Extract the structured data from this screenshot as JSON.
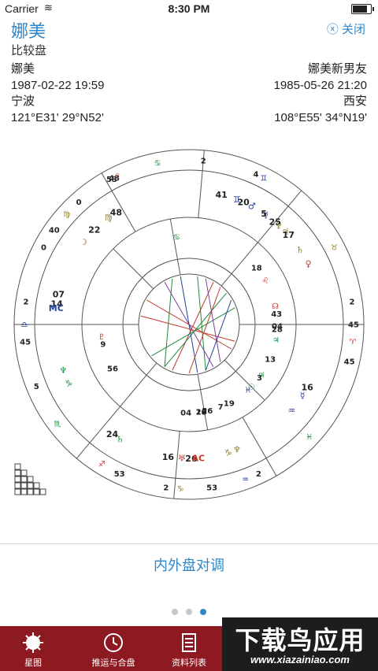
{
  "status_bar": {
    "carrier": "Carrier",
    "time": "8:30 PM",
    "battery_level": 0.9
  },
  "header": {
    "title": "娜美",
    "close_label": "ⓧ 关闭",
    "subtitle": "比较盘"
  },
  "person_left": {
    "name": "娜美",
    "datetime": "1987-02-22 19:59",
    "place": "宁波",
    "coords": "121°E31' 29°N52'"
  },
  "person_right": {
    "name": "娜美新男友",
    "datetime": "1985-05-26 21:20",
    "place": "西安",
    "coords": "108°E55' 34°N19'"
  },
  "chart_data": {
    "type": "astrology-biwheel",
    "outer_labels": [
      {
        "text": "2",
        "deg": 95
      },
      {
        "text": "53",
        "deg": 62
      },
      {
        "text": "♋",
        "deg": 79,
        "color": "#1e8a3a"
      },
      {
        "text": "4",
        "deg": 114
      },
      {
        "text": "♊",
        "deg": 117,
        "color": "#233f9c"
      },
      {
        "text": "♉",
        "deg": 152,
        "color": "#8a7d20"
      },
      {
        "text": "2",
        "deg": 172
      },
      {
        "text": "45",
        "deg": 180
      },
      {
        "text": "♈",
        "deg": 186,
        "color": "#c0392b"
      },
      {
        "text": "45",
        "deg": 193
      },
      {
        "text": "♓",
        "deg": 223,
        "color": "#1e8a3a"
      },
      {
        "text": "2",
        "deg": 245
      },
      {
        "text": "♒",
        "deg": 250,
        "color": "#233f9c"
      },
      {
        "text": "53",
        "deg": 262
      },
      {
        "text": "♑",
        "deg": 273,
        "color": "#8a7d20"
      },
      {
        "text": "2",
        "deg": 278
      },
      {
        "text": "53",
        "deg": 295
      },
      {
        "text": "♐",
        "deg": 302,
        "color": "#c0392b"
      },
      {
        "text": "5",
        "deg": 338
      },
      {
        "text": "♏",
        "deg": 323,
        "color": "#1e8a3a"
      },
      {
        "text": "45",
        "deg": 354
      },
      {
        "text": "♎",
        "deg": 0,
        "color": "#233f9c"
      },
      {
        "text": "2",
        "deg": 8
      },
      {
        "text": "0",
        "deg": 28
      },
      {
        "text": "40",
        "deg": 35
      },
      {
        "text": "♍",
        "deg": 42,
        "color": "#8a7d20"
      },
      {
        "text": "0",
        "deg": 48
      },
      {
        "text": "43",
        "deg": 63
      },
      {
        "text": "♌",
        "deg": 64,
        "color": "#c0392b"
      }
    ],
    "outer_planets": [
      {
        "text": "♂",
        "deg": 118,
        "color": "#233f9c"
      },
      {
        "text": "20",
        "deg": 114
      },
      {
        "text": "♊",
        "deg": 111,
        "color": "#233f9c"
      },
      {
        "text": "41",
        "deg": 104
      },
      {
        "text": "☿",
        "deg": 125,
        "color": "#233f9c"
      },
      {
        "text": "5",
        "deg": 124
      },
      {
        "text": "♃",
        "deg": 136,
        "color": "#8a7d20"
      },
      {
        "text": "17",
        "deg": 138
      },
      {
        "text": "♄",
        "deg": 146,
        "color": "#8a7d20"
      },
      {
        "text": "♀",
        "deg": 132,
        "color": "#8a7d20"
      },
      {
        "text": "25",
        "deg": 130
      },
      {
        "text": "♀",
        "deg": 153,
        "color": "#c0392b"
      },
      {
        "text": "☽",
        "deg": 38,
        "color": "#c0392b"
      },
      {
        "text": "22",
        "deg": 45
      },
      {
        "text": "♍",
        "deg": 53,
        "color": "#8a7d20"
      },
      {
        "text": "48",
        "deg": 57
      },
      {
        "text": "14",
        "deg": 9
      },
      {
        "text": "07",
        "deg": 13
      },
      {
        "text": "MC",
        "deg": 7,
        "color": "#233f9c"
      },
      {
        "text": "♆",
        "deg": 340,
        "color": "#1e8a3a"
      },
      {
        "text": "♑",
        "deg": 334,
        "color": "#1e8a3a"
      },
      {
        "text": "24",
        "deg": 305
      },
      {
        "text": "♄",
        "deg": 301,
        "color": "#1e8a3a"
      },
      {
        "text": "16",
        "deg": 279
      },
      {
        "text": "♅",
        "deg": 273,
        "color": "#c0392b"
      },
      {
        "text": "26",
        "deg": 269
      },
      {
        "text": "AC",
        "deg": 266,
        "color": "#c0392b"
      },
      {
        "text": "♑",
        "deg": 253,
        "color": "#8a7d20"
      },
      {
        "text": "♆",
        "deg": 249,
        "color": "#8a7d20"
      },
      {
        "text": "♒",
        "deg": 220,
        "color": "#233f9c"
      },
      {
        "text": "16",
        "deg": 208
      },
      {
        "text": "☿",
        "deg": 212,
        "color": "#233f9c"
      }
    ],
    "inner_labels": [
      {
        "text": "♋",
        "deg": 82,
        "color": "#1e8a3a"
      },
      {
        "text": "18",
        "deg": 140
      },
      {
        "text": "43",
        "deg": 173
      },
      {
        "text": "♌",
        "deg": 150,
        "color": "#c0392b"
      },
      {
        "text": "☊",
        "deg": 168,
        "color": "#c0392b"
      },
      {
        "text": "04",
        "deg": 181
      },
      {
        "text": "28",
        "deg": 183
      },
      {
        "text": "♃",
        "deg": 190,
        "color": "#1e8a3a"
      },
      {
        "text": "13",
        "deg": 203
      },
      {
        "text": "♃",
        "deg": 215,
        "color": "#1e8a3a"
      },
      {
        "text": "3",
        "deg": 217
      },
      {
        "text": "☉",
        "deg": 225,
        "color": "#1e8a3a"
      },
      {
        "text": "♓",
        "deg": 228,
        "color": "#233f9c"
      },
      {
        "text": "56",
        "deg": 330
      },
      {
        "text": "9",
        "deg": 347
      },
      {
        "text": "♇",
        "deg": 352,
        "color": "#c0392b"
      },
      {
        "text": "04",
        "deg": 272
      },
      {
        "text": "18",
        "deg": 262
      },
      {
        "text": "20",
        "deg": 262
      },
      {
        "text": "26",
        "deg": 258
      },
      {
        "text": "7",
        "deg": 249
      },
      {
        "text": "19",
        "deg": 243
      }
    ],
    "houses_deg": [
      0,
      60,
      95,
      130,
      180,
      240,
      275,
      310
    ],
    "inner_houses_deg": [
      0,
      45,
      80,
      130,
      180,
      225,
      260,
      310
    ]
  },
  "swap_label": "内外盘对调",
  "page_dots": {
    "count": 3,
    "active": 2
  },
  "tabs": [
    {
      "label": "星图",
      "icon": "chart-icon"
    },
    {
      "label": "推运与合盘",
      "icon": "clock-icon"
    },
    {
      "label": "资料列表",
      "icon": "list-icon"
    }
  ],
  "watermark": {
    "line1": "下载鸟应用",
    "line2": "www.xiazainiao.com"
  }
}
